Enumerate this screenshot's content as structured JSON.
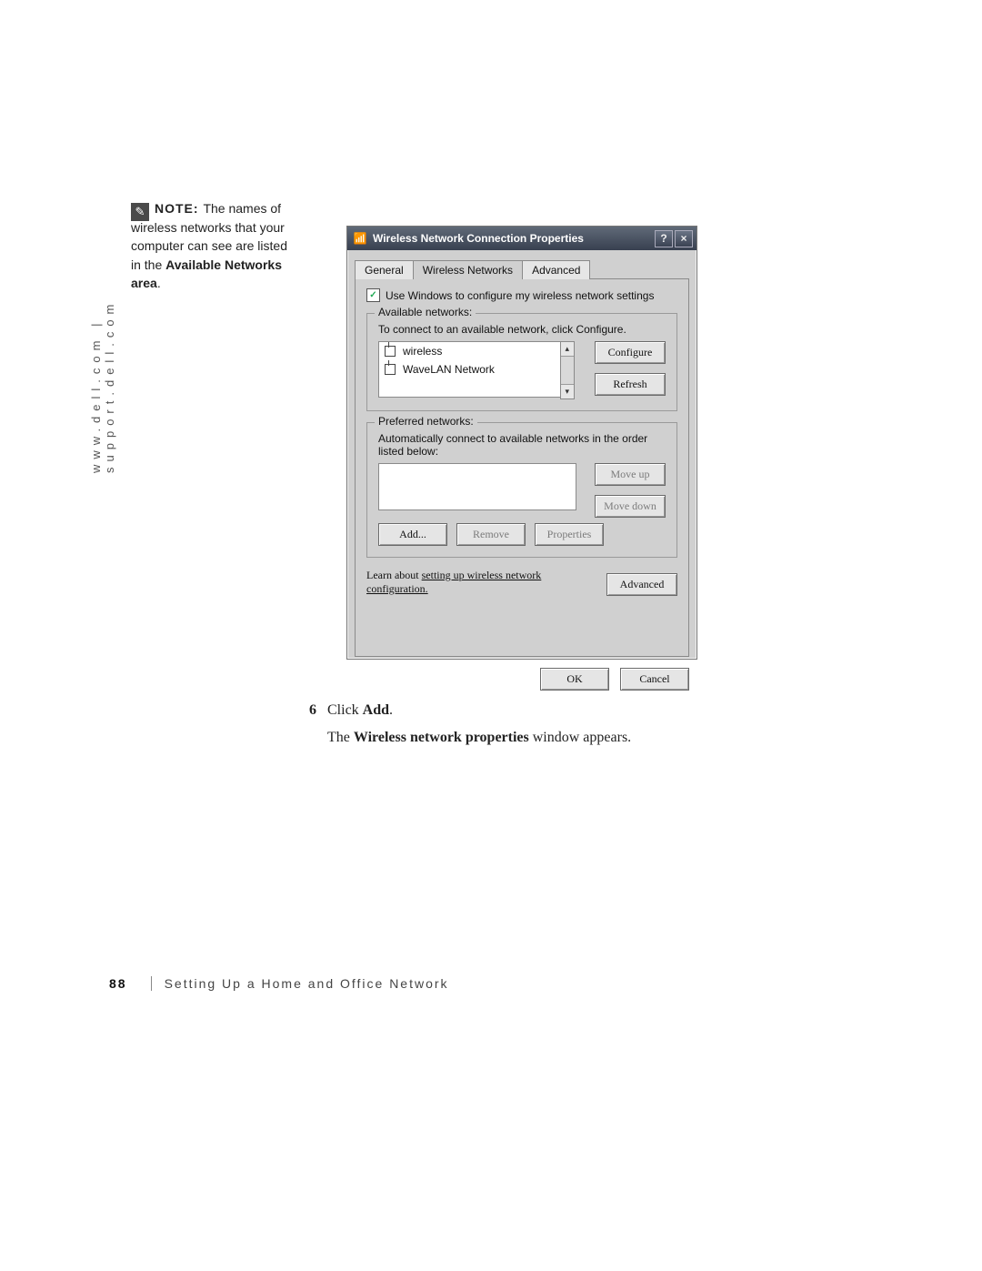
{
  "side_url": "www.dell.com | support.dell.com",
  "note": {
    "title": "NOTE: ",
    "text1": "The names of wireless networks that your computer can see are listed in the ",
    "strong": "Available Networks area",
    "text2": "."
  },
  "dialog": {
    "title": "Wireless Network Connection Properties",
    "tabs": [
      "General",
      "Wireless Networks",
      "Advanced"
    ],
    "use_windows": "Use Windows to configure my wireless network settings",
    "available": {
      "legend": "Available networks:",
      "instruction": "To connect to an available network, click Configure.",
      "items": [
        "wireless",
        "WaveLAN Network"
      ],
      "configure": "Configure",
      "refresh": "Refresh"
    },
    "preferred": {
      "legend": "Preferred networks:",
      "instruction": "Automatically connect to available networks in the order listed below:",
      "move_up": "Move up",
      "move_down": "Move down",
      "add": "Add...",
      "remove": "Remove",
      "properties": "Properties"
    },
    "learn": {
      "pre": "Learn about ",
      "link1": "setting up wireless network",
      "link2": "configuration."
    },
    "advanced_btn": "Advanced",
    "ok": "OK",
    "cancel": "Cancel"
  },
  "body": {
    "step_num": "6",
    "step_click": "Click",
    "step_add": "Add",
    "step2_pre": "The",
    "step2_bold": "Wireless network properties",
    "step2_post": "window appears."
  },
  "footer": {
    "page": "88",
    "chapter": "Setting Up a Home and Office Network"
  }
}
